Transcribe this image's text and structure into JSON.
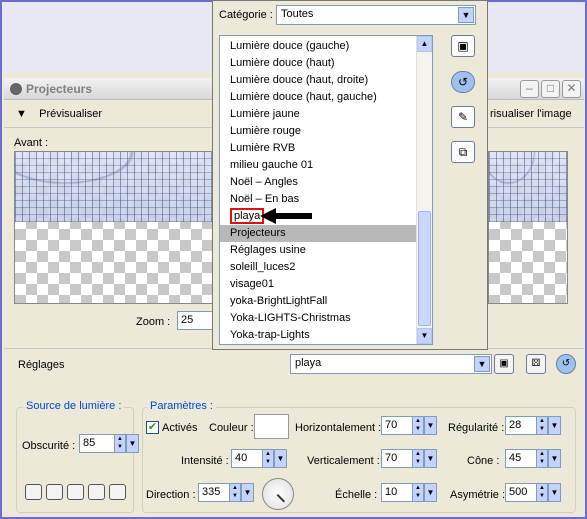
{
  "window": {
    "title": "Projecteurs"
  },
  "toolbar": {
    "preview_label": "Prévisualiser",
    "preview_image_label": "risualiser l'image"
  },
  "preview": {
    "before_label": "Avant :"
  },
  "zoom": {
    "label": "Zoom :",
    "value": "25"
  },
  "settings": {
    "label": "Réglages",
    "selected": "playa"
  },
  "category": {
    "label": "Catégorie :",
    "selected": "Toutes",
    "items": [
      "Lumière douce (gauche)",
      "Lumière douce (haut)",
      "Lumière douce (haut, droite)",
      "Lumière douce (haut, gauche)",
      "Lumière jaune",
      "Lumière rouge",
      "Lumière RVB",
      "milieu gauche 01",
      "Noël – Angles",
      "Noël – En bas",
      "playa",
      "Projecteurs",
      "Réglages usine",
      "soleill_luces2",
      "visage01",
      "yoka-BrightLightFall",
      "Yoka-LIGHTS-Christmas",
      "Yoka-trap-Lights"
    ],
    "highlighted": "Projecteurs",
    "boxed": "playa"
  },
  "light_source": {
    "group_label": "Source de lumière :",
    "obscurity_label": "Obscurité :",
    "obscurity_value": "85"
  },
  "params": {
    "group_label": "Paramètres :",
    "active_label": "Activés",
    "color_label": "Couleur :",
    "intensity_label": "Intensité :",
    "intensity_value": "40",
    "direction_label": "Direction :",
    "direction_value": "335",
    "horizontal_label": "Horizontalement :",
    "horizontal_value": "70",
    "vertical_label": "Verticalement :",
    "vertical_value": "70",
    "scale_label": "Échelle :",
    "scale_value": "10",
    "regularity_label": "Régularité :",
    "regularity_value": "28",
    "cone_label": "Cône :",
    "cone_value": "45",
    "asymmetry_label": "Asymétrie :",
    "asymmetry_value": "500"
  }
}
